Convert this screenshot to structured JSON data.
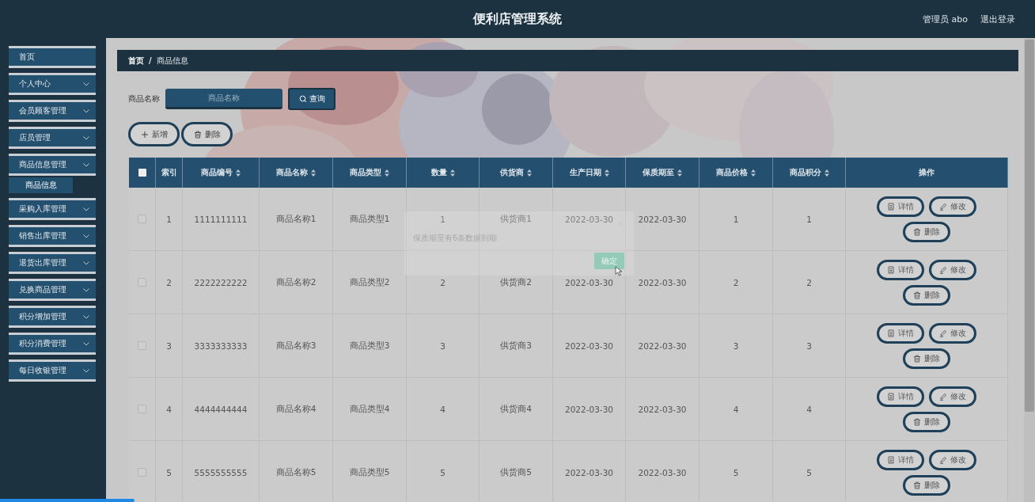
{
  "header": {
    "title": "便利店管理系统",
    "user": "管理员 abo",
    "logout": "退出登录"
  },
  "sidebar": {
    "items": [
      {
        "label": "首页",
        "kind": "link"
      },
      {
        "label": "个人中心",
        "kind": "menu"
      },
      {
        "label": "会员顾客管理",
        "kind": "menu"
      },
      {
        "label": "店员管理",
        "kind": "menu"
      },
      {
        "label": "商品信息管理",
        "kind": "menu",
        "children": [
          {
            "label": "商品信息",
            "selected": true
          }
        ]
      },
      {
        "label": "采购入库管理",
        "kind": "menu"
      },
      {
        "label": "销售出库管理",
        "kind": "menu"
      },
      {
        "label": "退货出库管理",
        "kind": "menu"
      },
      {
        "label": "兑换商品管理",
        "kind": "menu"
      },
      {
        "label": "积分增加管理",
        "kind": "menu"
      },
      {
        "label": "积分消费管理",
        "kind": "menu"
      },
      {
        "label": "每日收银管理",
        "kind": "menu"
      }
    ]
  },
  "breadcrumb": {
    "items": [
      "首页",
      "商品信息"
    ],
    "separator": "/"
  },
  "search": {
    "label": "商品名称",
    "placeholder": "商品名称",
    "button": "查询"
  },
  "actions": [
    {
      "label": "新增",
      "kind": "add"
    },
    {
      "label": "删除",
      "kind": "delete"
    }
  ],
  "table": {
    "select_all": {
      "checked": false
    },
    "columns": [
      {
        "label": "索引",
        "sortable": false
      },
      {
        "label": "商品编号",
        "sortable": true
      },
      {
        "label": "商品名称",
        "sortable": true
      },
      {
        "label": "商品类型",
        "sortable": true
      },
      {
        "label": "数量",
        "sortable": true
      },
      {
        "label": "供货商",
        "sortable": true
      },
      {
        "label": "生产日期",
        "sortable": true
      },
      {
        "label": "保质期至",
        "sortable": true
      },
      {
        "label": "商品价格",
        "sortable": true
      },
      {
        "label": "商品积分",
        "sortable": true
      },
      {
        "label": "操作",
        "sortable": false
      }
    ],
    "rows": [
      {
        "checked": false,
        "cells": [
          "1",
          "1111111111",
          "商品名称1",
          "商品类型1",
          "1",
          "供货商1",
          "2022-03-30",
          "2022-03-30",
          "1",
          "1"
        ],
        "actions": [
          {
            "label": "详情",
            "kind": "detail"
          },
          {
            "label": "修改",
            "kind": "edit"
          },
          {
            "label": "删除",
            "kind": "delete"
          }
        ]
      },
      {
        "checked": false,
        "cells": [
          "2",
          "2222222222",
          "商品名称2",
          "商品类型2",
          "2",
          "供货商2",
          "2022-03-30",
          "2022-03-30",
          "2",
          "2"
        ],
        "actions": [
          {
            "label": "详情",
            "kind": "detail"
          },
          {
            "label": "修改",
            "kind": "edit"
          },
          {
            "label": "删除",
            "kind": "delete"
          }
        ]
      },
      {
        "checked": false,
        "cells": [
          "3",
          "3333333333",
          "商品名称3",
          "商品类型3",
          "3",
          "供货商3",
          "2022-03-30",
          "2022-03-30",
          "3",
          "3"
        ],
        "actions": [
          {
            "label": "详情",
            "kind": "detail"
          },
          {
            "label": "修改",
            "kind": "edit"
          },
          {
            "label": "删除",
            "kind": "delete"
          }
        ]
      },
      {
        "checked": false,
        "cells": [
          "4",
          "4444444444",
          "商品名称4",
          "商品类型4",
          "4",
          "供货商4",
          "2022-03-30",
          "2022-03-30",
          "4",
          "4"
        ],
        "actions": [
          {
            "label": "详情",
            "kind": "detail"
          },
          {
            "label": "修改",
            "kind": "edit"
          },
          {
            "label": "删除",
            "kind": "delete"
          }
        ]
      },
      {
        "checked": false,
        "cells": [
          "5",
          "5555555555",
          "商品名称5",
          "商品类型5",
          "5",
          "供货商5",
          "2022-03-30",
          "2022-03-30",
          "5",
          "5"
        ],
        "actions": [
          {
            "label": "详情",
            "kind": "detail"
          },
          {
            "label": "修改",
            "kind": "edit"
          },
          {
            "label": "删除",
            "kind": "delete"
          }
        ]
      }
    ]
  },
  "dialog": {
    "message": "保质期至有6条数据到期",
    "button": "确定"
  }
}
